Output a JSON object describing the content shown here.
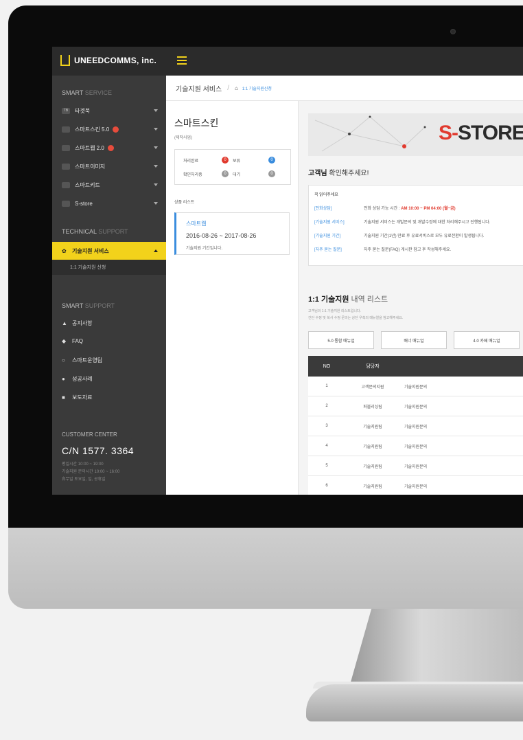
{
  "brand": {
    "logo_text": "UNEEDCOMMS, inc."
  },
  "sidebar": {
    "smart_service": {
      "title_main": "SMART",
      "title_dim": "SERVICE",
      "items": [
        {
          "label": "타겟북",
          "badge": false
        },
        {
          "label": "스마트스킨 5.0",
          "badge": true
        },
        {
          "label": "스마트웹 2.0",
          "badge": true
        },
        {
          "label": "스마트이미지",
          "badge": false
        },
        {
          "label": "스마트키트",
          "badge": false
        },
        {
          "label": "S-store",
          "badge": false
        }
      ]
    },
    "technical_support": {
      "title_main": "TECHNICAL",
      "title_dim": "SUPPORT",
      "active_label": "기술지원 서비스",
      "sub_label": "1:1 기술지원 신청"
    },
    "smart_support": {
      "title_main": "SMART",
      "title_dim": "SUPPORT",
      "items": [
        "공지사항",
        "FAQ",
        "스마트운영팀",
        "성공사례",
        "보도자료"
      ]
    },
    "customer_center": {
      "title": "CUSTOMER CENTER",
      "phone": "C/N  1577. 3364",
      "lines": [
        "평일시간 10:00 ~ 19:00",
        "기술지원 문의시간 10:00 ~ 16:00",
        "휴무일 토요일, 일, 공휴일"
      ]
    }
  },
  "breadcrumb": {
    "title": "기술지원 서비스",
    "sep": "/",
    "home": "⌂",
    "link": "1:1 기술지원신청"
  },
  "left_panel": {
    "title": "스마트스킨",
    "subtitle": "(제작사업)",
    "status": [
      {
        "label": "처리완료",
        "count": "0",
        "label2": "보류",
        "count2": "0"
      },
      {
        "label": "확인처리중",
        "count": "0",
        "label2": "대기",
        "count2": "0"
      }
    ],
    "list_title": "상품 리스트",
    "product": {
      "name": "스마트웹",
      "dates": "2016-08-26 ~ 2017-08-26",
      "note": "기술지원 기간입니다."
    }
  },
  "banner": {
    "title_red": "S-",
    "title_rest": "STORE"
  },
  "notice": {
    "heading_bold": "고객님",
    "heading_rest": " 확인해주세요!",
    "box_title": "꼭 읽어주세요",
    "rows": [
      {
        "tag": "[전화상담]",
        "text": "전화 상담 가능 시간 : ",
        "highlight": "AM 10:00 ~ PM 04:00 (월~금)"
      },
      {
        "tag": "[기술지원 서비스]",
        "text": "기술지원 서비스는 개발문의 및 개발수정에 대한 처리해주시고 진행됩니다.",
        "highlight": ""
      },
      {
        "tag": "[기술지원 기간]",
        "text": "기술지원 기간(1년) 만료 후 유료서비스로 모두 유료전환이 발생됩니다.",
        "highlight": ""
      },
      {
        "tag": "[자주 묻는 질문]",
        "text": "자주 묻는 질문(FAQ) 게시판 참고 후 작성해주세요.",
        "highlight": ""
      }
    ]
  },
  "support_list": {
    "title_bold": "1:1 기술지원",
    "title_rest": " 내역 리스트",
    "desc1": "고객님의 1:1 기술지원 리스트입니다.",
    "desc2": "간단 수정 및 복사 수정 문의는 상단 우측의 매뉴얼을 참고해주세요.",
    "buttons": [
      "5.0 통합 매뉴얼",
      "배너 매뉴얼",
      "4.0 카페 매뉴얼"
    ],
    "columns": {
      "no": "NO",
      "manager": "담당자"
    },
    "rows": [
      {
        "no": "1",
        "manager": "고객문의지원",
        "category": "기술지원문의"
      },
      {
        "no": "2",
        "manager": "퍼블리싱팀",
        "category": "기술지원문의"
      },
      {
        "no": "3",
        "manager": "기술지원팀",
        "category": "기술지원문의"
      },
      {
        "no": "4",
        "manager": "기술지원팀",
        "category": "기술지원문의"
      },
      {
        "no": "5",
        "manager": "기술지원팀",
        "category": "기술지원문의"
      },
      {
        "no": "6",
        "manager": "기술지원팀",
        "category": "기술지원문의"
      }
    ]
  },
  "colors": {
    "accent_yellow": "#f2d21b",
    "accent_red": "#e13a2e",
    "link_blue": "#3a8dde",
    "sidebar_bg": "#3a3a3a"
  }
}
